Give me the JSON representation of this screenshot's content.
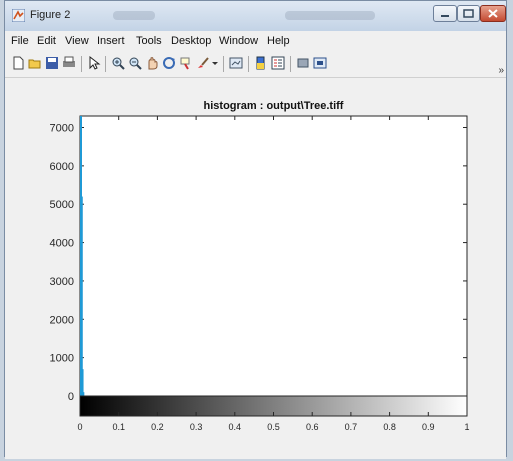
{
  "window": {
    "title": "Figure 2",
    "colors": {
      "titlebar": "#c8d6e8",
      "close": "#c8462f",
      "frame": "#7a8ca3",
      "plot_line": "#1f9ad6"
    }
  },
  "menu": [
    "File",
    "Edit",
    "View",
    "Insert",
    "Tools",
    "Desktop",
    "Window",
    "Help"
  ],
  "toolbar": {
    "icons": [
      "new-figure-icon",
      "open-file-icon",
      "save-icon",
      "print-icon",
      "pointer-icon",
      "zoom-in-icon",
      "zoom-out-icon",
      "pan-icon",
      "rotate-3d-icon",
      "data-cursor-icon",
      "brush-icon",
      "link-plot-icon",
      "colorbar-icon",
      "legend-icon",
      "hide-plot-tools-icon",
      "show-plot-tools-icon"
    ]
  },
  "chart_data": {
    "type": "bar",
    "title": "histogram : output\\Tree.tiff",
    "xlabel": "",
    "ylabel": "",
    "xlim": [
      0,
      1
    ],
    "ylim": [
      0,
      7300
    ],
    "yticks": [
      0,
      1000,
      2000,
      3000,
      4000,
      5000,
      6000,
      7000
    ],
    "xticks": [
      0,
      0.1,
      0.2,
      0.3,
      0.4,
      0.5,
      0.6,
      0.7,
      0.8,
      0.9,
      1
    ],
    "xtick_labels": [
      "0",
      "0.1",
      "0.2",
      "0.3",
      "0.4",
      "0.5",
      "0.6",
      "0.7",
      "0.8",
      "0.9",
      "1"
    ],
    "series": [
      {
        "x": [
          0.0,
          0.002,
          0.004,
          0.006,
          0.5,
          1.0
        ],
        "values": [
          7300,
          5200,
          700,
          100,
          0,
          0
        ]
      }
    ],
    "colorbar": "grayscale",
    "grid": false
  }
}
